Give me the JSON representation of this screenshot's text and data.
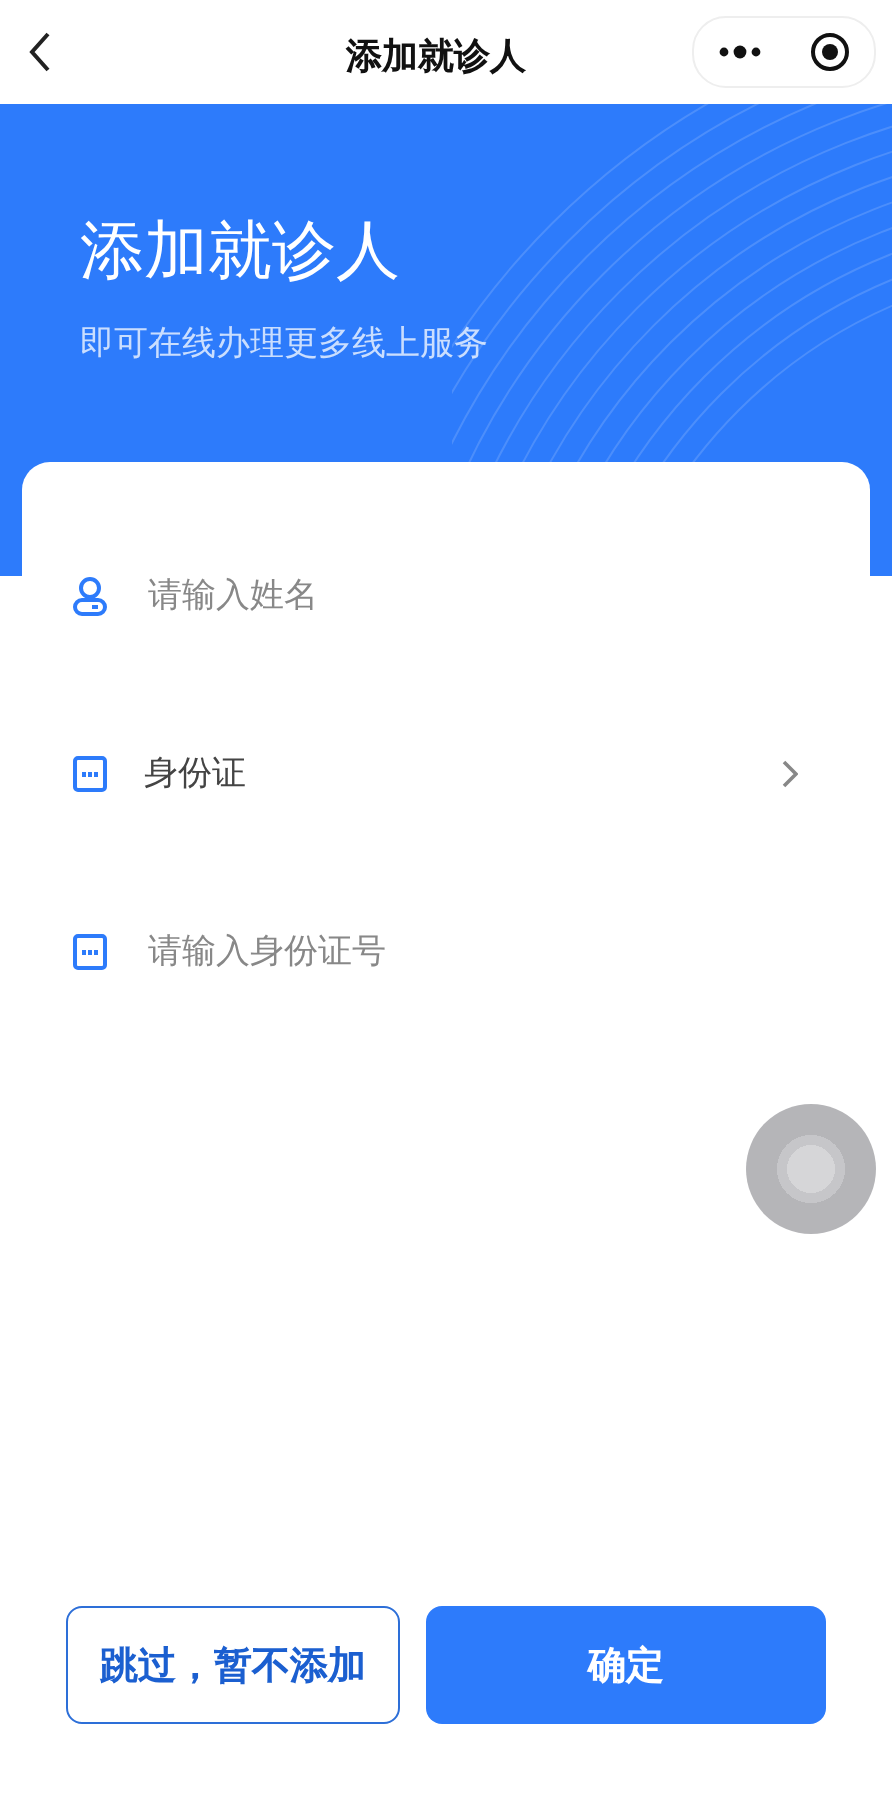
{
  "nav": {
    "title": "添加就诊人"
  },
  "header": {
    "title": "添加就诊人",
    "subtitle": "即可在线办理更多线上服务"
  },
  "fields": [
    {
      "kind": "name",
      "placeholder": "请输入姓名"
    },
    {
      "kind": "id_type",
      "value": "身份证"
    },
    {
      "kind": "id_number",
      "placeholder": "请输入身份证号"
    }
  ],
  "buttons": [
    {
      "kind": "outline",
      "label": "跳过，暂不添加"
    },
    {
      "kind": "primary",
      "label": "确定"
    }
  ]
}
